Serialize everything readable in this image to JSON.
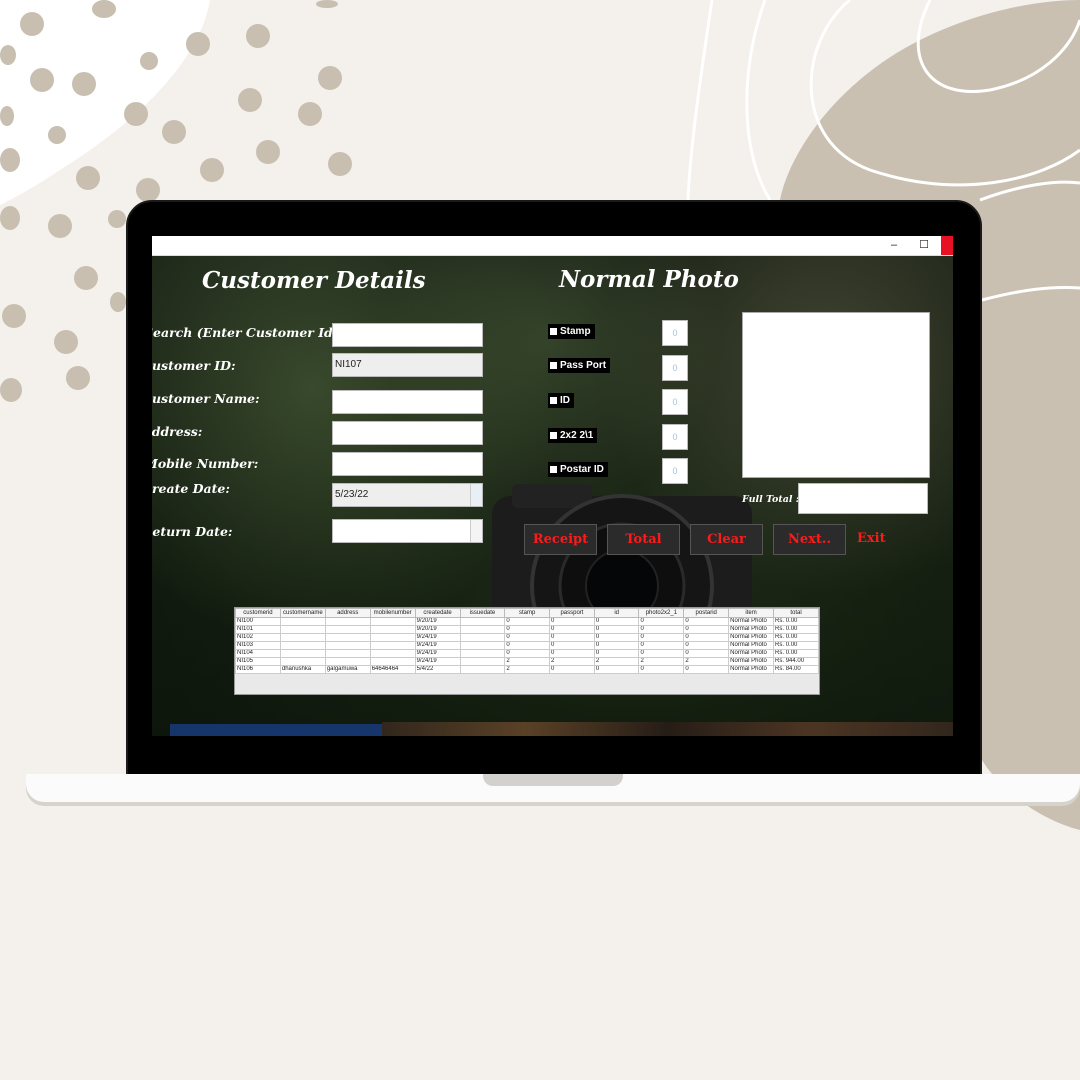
{
  "form": {
    "customer_heading": "Customer Details",
    "photo_heading": "Normal Photo",
    "labels": {
      "search": "Search (Enter Customer Id):",
      "customer_id": "Customer ID:",
      "customer_name": "Customer Name:",
      "address": "Address:",
      "mobile": "Mobile Number:",
      "create_date": "Create Date:",
      "return_date": "Return Date:"
    },
    "values": {
      "search": "",
      "customer_id": "NI107",
      "customer_name": "",
      "address": "",
      "mobile": "",
      "create_date": "5/23/22",
      "return_date": ""
    }
  },
  "photo_options": [
    {
      "label": "Stamp",
      "qty": "0"
    },
    {
      "label": "Pass Port",
      "qty": "0"
    },
    {
      "label": "ID",
      "qty": "0"
    },
    {
      "label": "2x2 2\\1",
      "qty": "0"
    },
    {
      "label": "Postar ID",
      "qty": "0"
    }
  ],
  "full_total_label": "Full Total :",
  "full_total_value": "",
  "buttons": {
    "receipt": "Receipt",
    "total": "Total",
    "clear": "Clear",
    "next": "Next..",
    "exit": "Exit"
  },
  "window_controls": {
    "minimize": "–",
    "maximize": "☐"
  },
  "table": {
    "headers": [
      "customerid",
      "customername",
      "address",
      "mobilenumber",
      "createdate",
      "issuedate",
      "stamp",
      "passport",
      "id",
      "photo2x2_1",
      "postarid",
      "item",
      "total"
    ],
    "rows": [
      [
        "NI100",
        "",
        "",
        "",
        "9/20/19",
        "",
        "0",
        "0",
        "0",
        "0",
        "0",
        "Normal Photo",
        "Rs. 0.00"
      ],
      [
        "NI101",
        "",
        "",
        "",
        "9/20/19",
        "",
        "0",
        "0",
        "0",
        "0",
        "0",
        "Normal Photo",
        "Rs. 0.00"
      ],
      [
        "NI102",
        "",
        "",
        "",
        "9/24/19",
        "",
        "0",
        "0",
        "0",
        "0",
        "0",
        "Normal Photo",
        "Rs. 0.00"
      ],
      [
        "NI103",
        "",
        "",
        "",
        "9/24/19",
        "",
        "0",
        "0",
        "0",
        "0",
        "0",
        "Normal Photo",
        "Rs. 0.00"
      ],
      [
        "NI104",
        "",
        "",
        "",
        "9/24/19",
        "",
        "0",
        "0",
        "0",
        "0",
        "0",
        "Normal Photo",
        "Rs. 0.00"
      ],
      [
        "NI105",
        "",
        "",
        "",
        "9/24/19",
        "",
        "2",
        "2",
        "2",
        "2",
        "2",
        "Normal Photo",
        "Rs. 944.00"
      ],
      [
        "NI106",
        "dhanushka",
        "galgamuwa",
        "64646464",
        "5/4/22",
        "",
        "2",
        "0",
        "0",
        "0",
        "0",
        "Normal Photo",
        "Rs. 84.00"
      ]
    ]
  },
  "colors": {
    "accent_red": "#ff1a1a",
    "background": "#f4f0eb",
    "decor": "#c8bfb1"
  }
}
